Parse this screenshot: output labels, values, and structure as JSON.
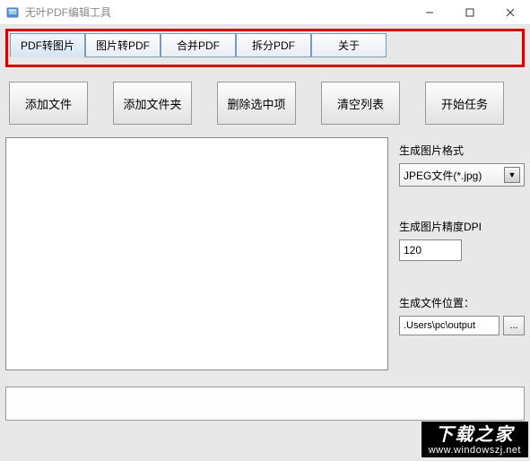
{
  "window": {
    "title": "无叶PDF编辑工具"
  },
  "tabs": [
    {
      "label": "PDF转图片"
    },
    {
      "label": "图片转PDF"
    },
    {
      "label": "合并PDF"
    },
    {
      "label": "拆分PDF"
    },
    {
      "label": "关于"
    }
  ],
  "toolbar": {
    "add_file": "添加文件",
    "add_folder": "添加文件夹",
    "remove_selected": "删除选中项",
    "clear_list": "清空列表",
    "start_task": "开始任务"
  },
  "side": {
    "format_label": "生成图片格式",
    "format_value": "JPEG文件(*.jpg)",
    "dpi_label": "生成图片精度DPI",
    "dpi_value": "120",
    "output_label": "生成文件位置：",
    "output_path": ".Users\\pc\\output",
    "browse": "..."
  },
  "watermark": {
    "cn": "下载之家",
    "url": "www.windowszj.net"
  }
}
